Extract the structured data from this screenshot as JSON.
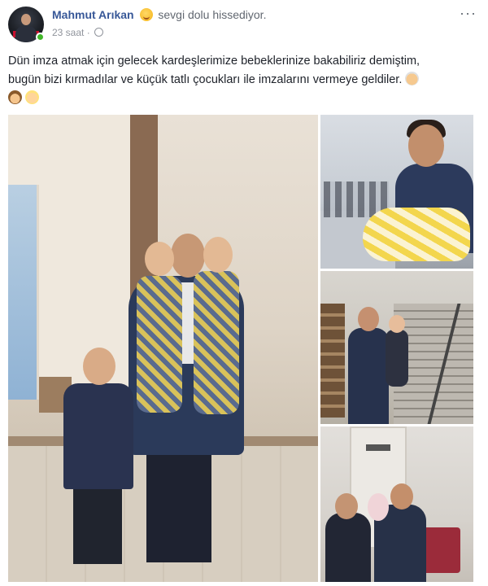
{
  "post": {
    "author": "Mahmut Arıkan",
    "activity": "sevgi dolu hissediyor.",
    "feeling_icon": "smiling-face-emoji",
    "timestamp": "23 saat",
    "separator": "·",
    "audience_icon": "globe-icon",
    "more_icon": "more-options-icon",
    "more_label": "···",
    "text_line1": "Dün imza atmak için gelecek kardeşlerimize bebeklerinize bakabiliriz demiştim,",
    "text_line2": "bugün bizi kırmadılar ve küçük tatlı çocukları ile imzalarını vermeye geldiler.",
    "trailing_emojis": [
      "old-man-emoji",
      "woman-emoji",
      "baby-emoji"
    ]
  },
  "photos": [
    {
      "name": "main-photo",
      "description_icon": "photo"
    },
    {
      "name": "photo-1",
      "description_icon": "photo"
    },
    {
      "name": "photo-2",
      "description_icon": "photo"
    },
    {
      "name": "photo-3",
      "description_icon": "photo"
    }
  ],
  "colors": {
    "author_link": "#385898",
    "meta_text": "#90949c",
    "online_status": "#42b72a"
  }
}
